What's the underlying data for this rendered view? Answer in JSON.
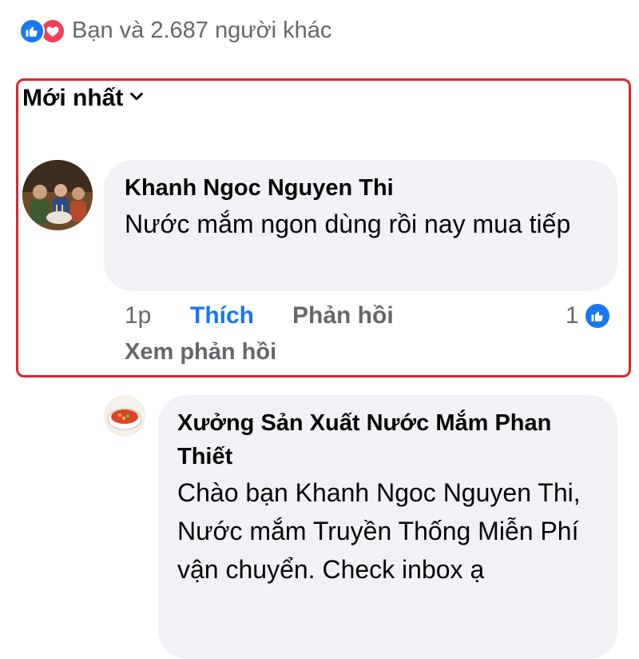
{
  "reactions_summary": {
    "icons": [
      "like-icon",
      "love-icon"
    ],
    "text": "Bạn và 2.687 người khác"
  },
  "sort": {
    "label": "Mới nhất",
    "icon": "chevron-down-icon"
  },
  "comment": {
    "author": "Khanh Ngoc Nguyen Thi",
    "text": "Nước mắm ngon dùng rồi nay mua tiếp",
    "time": "1p",
    "like_label": "Thích",
    "reply_label": "Phản hồi",
    "like_count": "1",
    "view_replies_label": "Xem phản hồi"
  },
  "reply": {
    "author": "Xưởng Sản Xuất Nước Mắm Phan Thiết",
    "text": "Chào bạn Khanh Ngoc Nguyen Thi, Nước mắm Truyền Thống Miễn Phí vận chuyển. Check inbox  ạ"
  },
  "colors": {
    "accent": "#1877f2",
    "love": "#f33e58",
    "highlight_border": "#d9262f",
    "bubble": "#f0f2f5",
    "secondary_text": "#65676b"
  }
}
